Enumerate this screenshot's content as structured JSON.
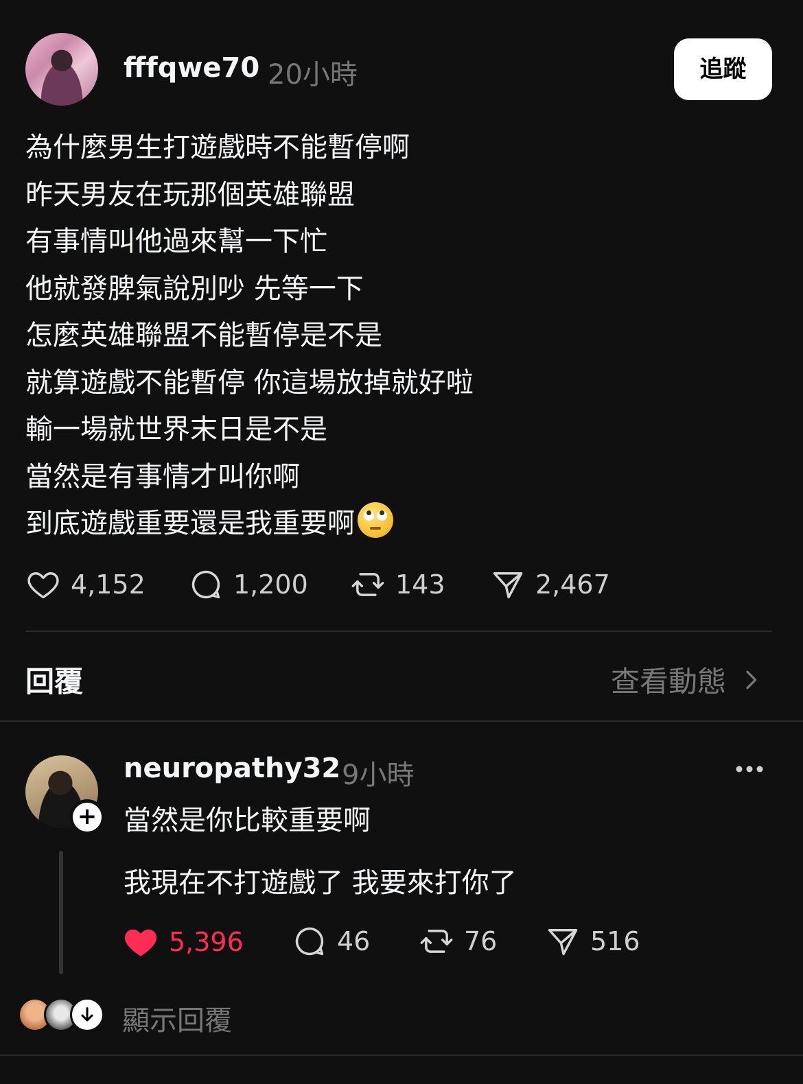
{
  "post": {
    "username": "fffqwe70",
    "time": "20小時",
    "follow_label": "追蹤",
    "lines": [
      "為什麼男生打遊戲時不能暫停啊",
      "昨天男友在玩那個英雄聯盟",
      "有事情叫他過來幫一下忙",
      "他就發脾氣說別吵 先等一下",
      "怎麼英雄聯盟不能暫停是不是",
      "就算遊戲不能暫停 你這場放掉就好啦",
      "輸一場就世界末日是不是",
      "當然是有事情才叫你啊",
      "到底遊戲重要還是我重要啊"
    ],
    "emoji": "face-with-rolling-eyes",
    "stats": {
      "likes": "4,152",
      "comments": "1,200",
      "reposts": "143",
      "shares": "2,467"
    }
  },
  "replies_header": {
    "title": "回覆",
    "view_activity": "查看動態"
  },
  "reply": {
    "username": "neuropathy32",
    "time": "9小時",
    "line1": "當然是你比較重要啊",
    "line2": "我現在不打遊戲了 我要來打你了",
    "stats": {
      "likes": "5,396",
      "comments": "46",
      "reposts": "76",
      "shares": "516"
    },
    "liked": true,
    "show_replies": "顯示回覆"
  },
  "colors": {
    "background": "#101010",
    "text": "#f3f5f7",
    "muted": "#777777",
    "like_red": "#ff2d55"
  }
}
